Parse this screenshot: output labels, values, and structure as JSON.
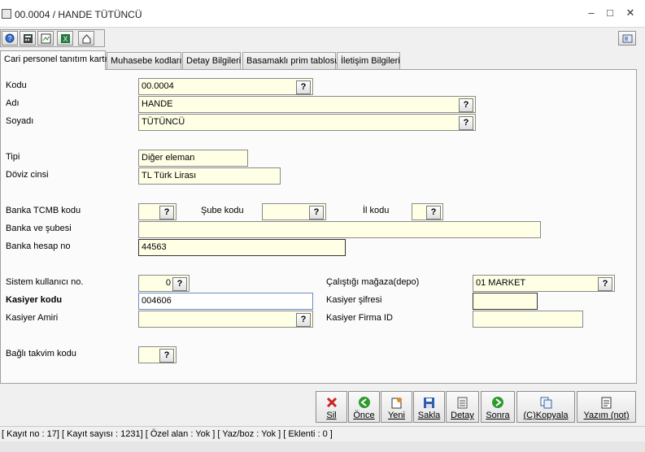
{
  "window": {
    "title": "00.0004 / HANDE  TÜTÜNCÜ"
  },
  "tabs": [
    {
      "label": "Cari personel tanıtım kartı"
    },
    {
      "label": "Muhasebe kodları"
    },
    {
      "label": "Detay Bilgileri"
    },
    {
      "label": "Basamaklı prim tablosu"
    },
    {
      "label": "İletişim Bilgileri"
    }
  ],
  "form": {
    "kodu": {
      "label": "Kodu",
      "value": "00.0004"
    },
    "adi": {
      "label": "Adı",
      "value": "HANDE"
    },
    "soyadi": {
      "label": "Soyadı",
      "value": "TÜTÜNCÜ"
    },
    "tipi": {
      "label": "Tipi",
      "value": "Diğer eleman"
    },
    "doviz": {
      "label": "Döviz cinsi",
      "value": "TL  Türk Lirası"
    },
    "banka_tcmb": {
      "label": "Banka TCMB kodu",
      "value": ""
    },
    "sube": {
      "label": "Şube kodu",
      "value": ""
    },
    "il": {
      "label": "İl kodu",
      "value": ""
    },
    "banka_sube": {
      "label": "Banka ve şubesi",
      "value": ""
    },
    "hesap_no": {
      "label": "Banka hesap no",
      "value": "44563"
    },
    "sistem_kullanici": {
      "label": "Sistem kullanıcı no.",
      "value": "0"
    },
    "magaza": {
      "label": "Çalıştığı mağaza(depo)",
      "value": "01  MARKET"
    },
    "kasiyer_kodu": {
      "label": "Kasiyer kodu",
      "value": "004606"
    },
    "kasiyer_sifresi": {
      "label": "Kasiyer şifresi",
      "value": ""
    },
    "kasiyer_amiri": {
      "label": "Kasiyer Amiri",
      "value": ""
    },
    "kasiyer_firma": {
      "label": "Kasiyer Firma ID",
      "value": ""
    },
    "takvim": {
      "label": "Bağlı takvim kodu",
      "value": ""
    },
    "lookup": "?"
  },
  "buttons": {
    "sil": "Sil",
    "once": "Önce",
    "yeni": "Yeni",
    "sakla": "Sakla",
    "detay": "Detay",
    "sonra": "Sonra",
    "kopyala": "(C)Kopyala",
    "yazim": "Yazım (not)"
  },
  "status": "[ Kayıt no : 17] [ Kayıt sayısı : 1231] [ Özel alan : Yok ] [ Yaz/boz : Yok ] [ Eklenti : 0 ]",
  "colors": {
    "field": "#ffffe6",
    "accent": "#2f5fb3",
    "delete": "#cc2222",
    "nav": "#2e9a2e"
  }
}
